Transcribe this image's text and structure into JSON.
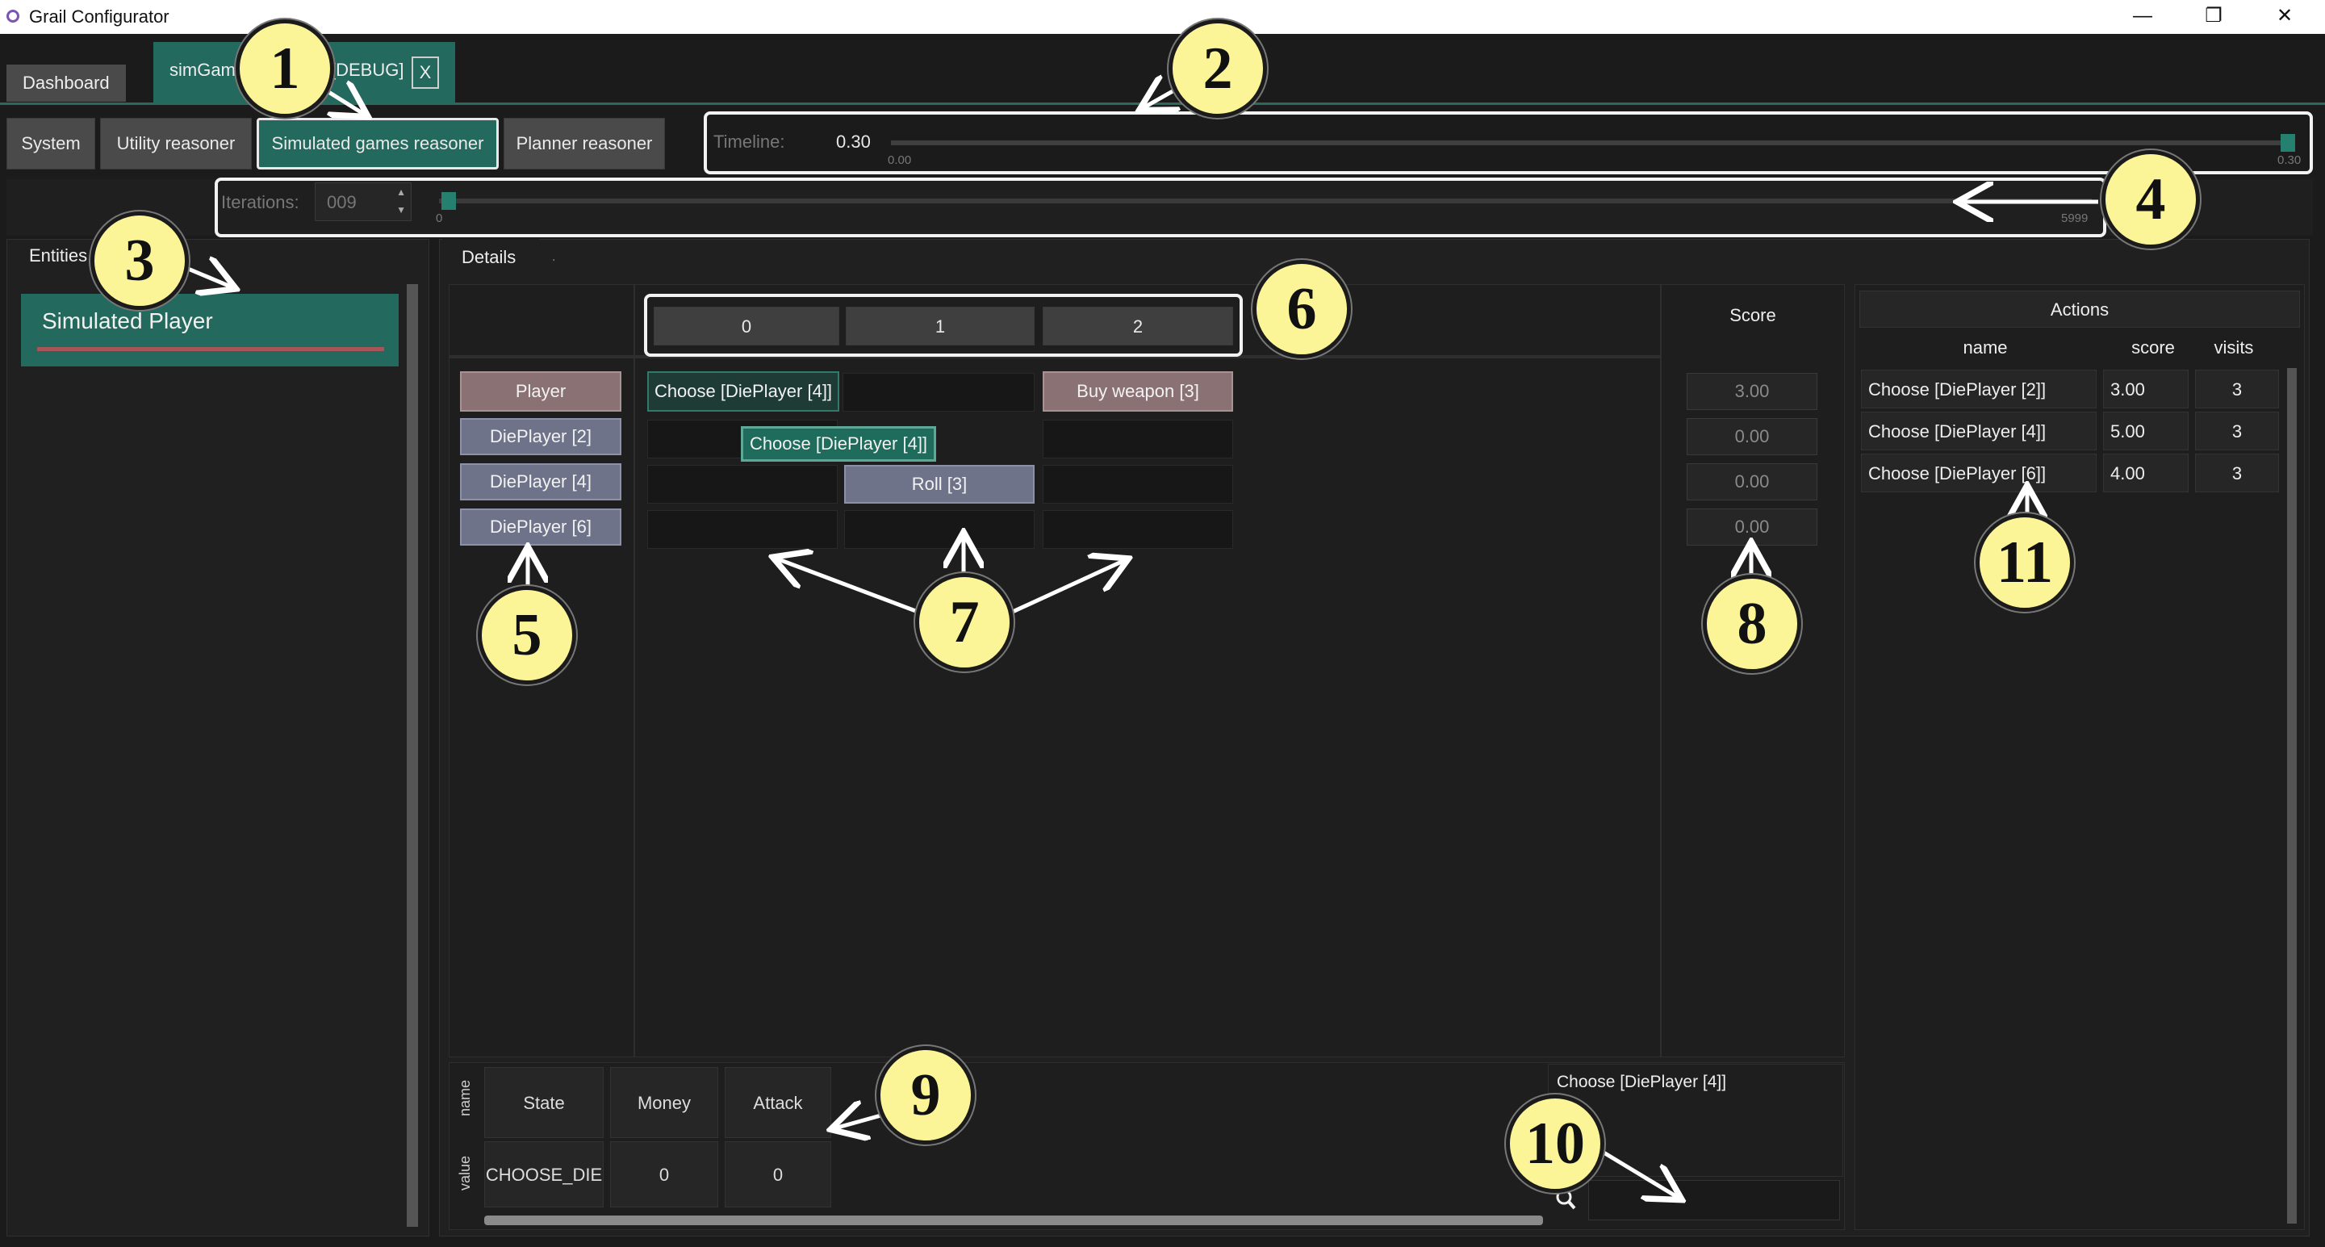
{
  "window": {
    "title": "Grail Configurator",
    "controls": [
      "—",
      "❐",
      "✕"
    ]
  },
  "tabs": {
    "dashboard": "Dashboard",
    "active": "simGame",
    "active_suffix": "[DEBUG]",
    "close": "X"
  },
  "reasoner_tabs": [
    "System",
    "Utility reasoner",
    "Simulated games reasoner",
    "Planner reasoner"
  ],
  "timeline": {
    "label": "Timeline:",
    "value": "0.30",
    "min": "0.00",
    "max": "0.30",
    "fraction": 1.0
  },
  "iterations": {
    "label": "Iterations:",
    "value": "009",
    "min": "0",
    "max": "5999",
    "fraction": 0.0015
  },
  "entities": {
    "tab": "Entities",
    "items": [
      {
        "label": "Simulated Player"
      }
    ]
  },
  "details": {
    "tab": "Details",
    "tab2": "."
  },
  "columns": [
    "0",
    "1",
    "2"
  ],
  "score_header": "Score",
  "rows": [
    "Player",
    "DiePlayer [2]",
    "DiePlayer [4]",
    "DiePlayer [6]"
  ],
  "moves": {
    "r0c0": "Choose [DiePlayer [4]]",
    "r0c2": "Buy weapon [3]",
    "r1c01": "Choose [DiePlayer [4]]",
    "r2c1": "Roll [3]"
  },
  "scores": [
    "3.00",
    "0.00",
    "0.00",
    "0.00"
  ],
  "state": {
    "name_label": "name",
    "value_label": "value",
    "names": [
      "State",
      "Money",
      "Attack"
    ],
    "values": [
      "CHOOSE_DIE",
      "0",
      "0"
    ]
  },
  "selected_action": "Choose [DiePlayer [4]]",
  "actions": {
    "title": "Actions",
    "headers": {
      "name": "name",
      "score": "score",
      "visits": "visits"
    },
    "rows": [
      {
        "name": "Choose [DiePlayer [2]]",
        "score": "3.00",
        "visits": "3"
      },
      {
        "name": "Choose [DiePlayer [4]]",
        "score": "5.00",
        "visits": "3"
      },
      {
        "name": "Choose [DiePlayer [6]]",
        "score": "4.00",
        "visits": "3"
      }
    ]
  },
  "callouts": [
    "1",
    "2",
    "3",
    "4",
    "5",
    "6",
    "7",
    "8",
    "9",
    "10",
    "11"
  ],
  "icons": {
    "search": "search-icon",
    "spin_up": "spin-up-icon",
    "spin_down": "spin-down-icon"
  }
}
